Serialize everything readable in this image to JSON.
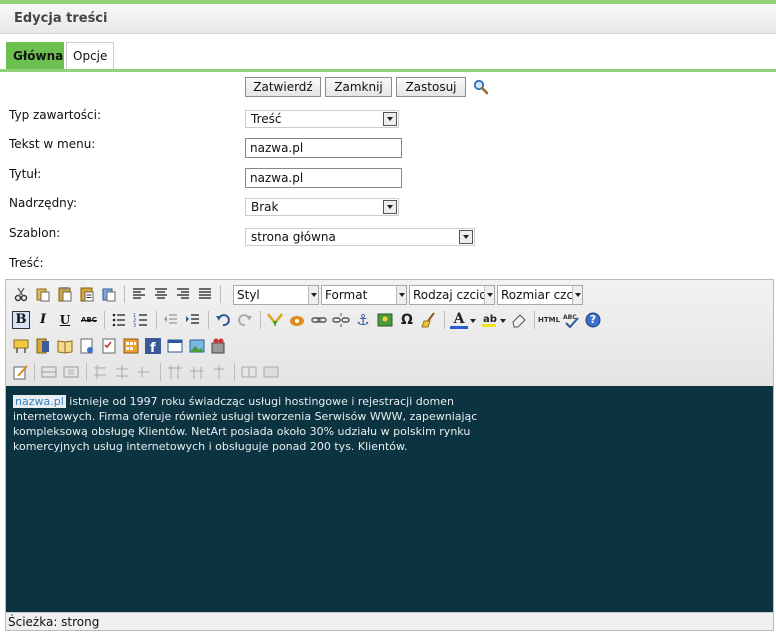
{
  "window": {
    "title": "Edycja treści",
    "accent_color": "#8fd27a",
    "active_tab_color": "#6cc050"
  },
  "tabs": [
    {
      "label": "Główna",
      "active": true
    },
    {
      "label": "Opcje",
      "active": false
    }
  ],
  "actions": {
    "confirm": "Zatwierdź",
    "close": "Zamknij",
    "apply": "Zastosuj"
  },
  "form": {
    "content_type": {
      "label": "Typ zawartości:",
      "value": "Treść"
    },
    "menu_text": {
      "label": "Tekst w menu:",
      "value": "nazwa.pl"
    },
    "title": {
      "label": "Tytuł:",
      "value": "nazwa.pl"
    },
    "parent": {
      "label": "Nadrzędny:",
      "value": "Brak"
    },
    "template": {
      "label": "Szablon:",
      "value": "strona główna"
    },
    "content": {
      "label": "Treść:"
    }
  },
  "toolbar": {
    "style": "Styl",
    "format": "Format",
    "font_family": "Rodzaj czcionki",
    "font_size": "Rozmiar czcionki",
    "bold": "B",
    "italic": "I",
    "underline": "U",
    "strike": "ABC",
    "html": "HTML",
    "anchor": "⚓",
    "omega": "Ω",
    "font_color": "A",
    "help": "?"
  },
  "editor": {
    "highlight": "nazwa.pl",
    "text": " istnieje od 1997 roku świadcząc usługi hostingowe i rejestracji domen internetowych. Firma oferuje również usługi tworzenia Serwisów WWW, zapewniając kompleksową obsługę Klientów. NetArt posiada około 30% udziału w polskim rynku komercyjnych usług internetowych i obsługuje ponad 200 tys. Klientów.",
    "background": "#0b3340"
  },
  "status": {
    "path": "Ścieżka: strong"
  }
}
